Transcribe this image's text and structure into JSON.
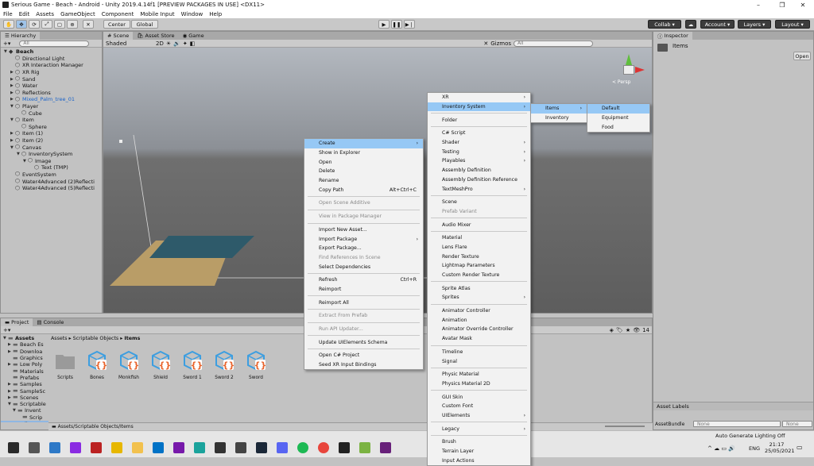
{
  "window": {
    "title": "Serious Game - Beach - Android - Unity 2019.4.14f1 [PREVIEW PACKAGES IN USE] <DX11>",
    "minimize_icon": "minimize-icon",
    "maximize_icon": "maximize-icon",
    "close_icon": "close-icon"
  },
  "menubar": [
    "File",
    "Edit",
    "Assets",
    "GameObject",
    "Component",
    "Mobile Input",
    "Window",
    "Help"
  ],
  "toolbar": {
    "pivot": "Center",
    "space": "Global",
    "collab": "Collab",
    "account": "Account",
    "layers": "Layers",
    "layout": "Layout"
  },
  "hierarchy": {
    "tab": "Hierarchy",
    "search_placeholder": "All",
    "items": [
      {
        "label": "Beach",
        "indent": 0,
        "arrow": "▼",
        "icon": "scene"
      },
      {
        "label": "Directional Light",
        "indent": 1,
        "arrow": "",
        "icon": "cube"
      },
      {
        "label": "XR Interaction Manager",
        "indent": 1,
        "arrow": "",
        "icon": "cube"
      },
      {
        "label": "XR Rig",
        "indent": 1,
        "arrow": "▶",
        "icon": "cube"
      },
      {
        "label": "Sand",
        "indent": 1,
        "arrow": "▶",
        "icon": "cube"
      },
      {
        "label": "Water",
        "indent": 1,
        "arrow": "▶",
        "icon": "cube"
      },
      {
        "label": "Reflections",
        "indent": 1,
        "arrow": "▶",
        "icon": "cube"
      },
      {
        "label": "Mixed_Palm_tree_01",
        "indent": 1,
        "arrow": "▶",
        "icon": "prefab",
        "blue": true
      },
      {
        "label": "Player",
        "indent": 1,
        "arrow": "▼",
        "icon": "cube"
      },
      {
        "label": "Cube",
        "indent": 2,
        "arrow": "",
        "icon": "cube"
      },
      {
        "label": "Item",
        "indent": 1,
        "arrow": "▼",
        "icon": "cube"
      },
      {
        "label": "Sphere",
        "indent": 2,
        "arrow": "",
        "icon": "cube"
      },
      {
        "label": "Item (1)",
        "indent": 1,
        "arrow": "▶",
        "icon": "cube"
      },
      {
        "label": "Item (2)",
        "indent": 1,
        "arrow": "▶",
        "icon": "cube"
      },
      {
        "label": "Canvas",
        "indent": 1,
        "arrow": "▼",
        "icon": "cube"
      },
      {
        "label": "InventorySystem",
        "indent": 2,
        "arrow": "▼",
        "icon": "cube"
      },
      {
        "label": "Image",
        "indent": 3,
        "arrow": "▼",
        "icon": "cube"
      },
      {
        "label": "Text (TMP)",
        "indent": 4,
        "arrow": "",
        "icon": "cube"
      },
      {
        "label": "EventSystem",
        "indent": 1,
        "arrow": "",
        "icon": "cube"
      },
      {
        "label": "Water4Advanced (2)Reflecti",
        "indent": 1,
        "arrow": "",
        "icon": "cube"
      },
      {
        "label": "Water4Advanced (5)Reflecti",
        "indent": 1,
        "arrow": "",
        "icon": "cube"
      }
    ]
  },
  "scene": {
    "tabs": [
      "Scene",
      "Asset Store",
      "Game"
    ],
    "shading": "Shaded",
    "mode_2d": "2D",
    "gizmos": "Gizmos",
    "search_placeholder": "All",
    "gizmo_label": "< Persp"
  },
  "inspector": {
    "tab": "Inspector",
    "title": "Items",
    "open_button": "Open",
    "asset_labels": "Asset Labels",
    "asset_bundle_label": "AssetBundle",
    "asset_bundle_value": "None",
    "asset_variant_value": "None"
  },
  "project": {
    "tabs": [
      "Project",
      "Console"
    ],
    "breadcrumb": [
      "Assets",
      "Scriptable Objects",
      "Items"
    ],
    "count": "14",
    "tree": [
      {
        "label": "Assets",
        "indent": 0,
        "arrow": "▼"
      },
      {
        "label": "Beach Es",
        "indent": 1,
        "arrow": "▶"
      },
      {
        "label": "Downloa",
        "indent": 1,
        "arrow": "▶"
      },
      {
        "label": "Graphics",
        "indent": 1,
        "arrow": ""
      },
      {
        "label": "Low Poly",
        "indent": 1,
        "arrow": "▶"
      },
      {
        "label": "Materials",
        "indent": 1,
        "arrow": ""
      },
      {
        "label": "Prefabs",
        "indent": 1,
        "arrow": ""
      },
      {
        "label": "Samples",
        "indent": 1,
        "arrow": "▶"
      },
      {
        "label": "SampleSc",
        "indent": 1,
        "arrow": "▶"
      },
      {
        "label": "Scenes",
        "indent": 1,
        "arrow": "▶"
      },
      {
        "label": "Scriptable",
        "indent": 1,
        "arrow": "▼"
      },
      {
        "label": "Invent",
        "indent": 2,
        "arrow": "▼"
      },
      {
        "label": "Scrip",
        "indent": 3,
        "arrow": ""
      },
      {
        "label": "Items",
        "indent": 2,
        "arrow": "",
        "selected": true
      }
    ],
    "assets": [
      {
        "label": "Scripts",
        "type": "folder"
      },
      {
        "label": "Bones",
        "type": "scriptable"
      },
      {
        "label": "Monkfish",
        "type": "scriptable"
      },
      {
        "label": "Shield",
        "type": "scriptable"
      },
      {
        "label": "Sword 1",
        "type": "scriptable"
      },
      {
        "label": "Sword 2",
        "type": "scriptable"
      },
      {
        "label": "Sword",
        "type": "scriptable"
      }
    ],
    "footer_path": "Assets/Scriptable Objects/Items"
  },
  "status": {
    "lighting": "Auto Generate Lighting Off"
  },
  "context_menu": [
    {
      "label": "Create",
      "sub": true,
      "hl": true
    },
    {
      "label": "Show in Explorer"
    },
    {
      "label": "Open"
    },
    {
      "label": "Delete"
    },
    {
      "label": "Rename"
    },
    {
      "label": "Copy Path",
      "shortcut": "Alt+Ctrl+C"
    },
    {
      "sep": true
    },
    {
      "label": "Open Scene Additive",
      "disabled": true
    },
    {
      "sep": true
    },
    {
      "label": "View in Package Manager",
      "disabled": true
    },
    {
      "sep": true
    },
    {
      "label": "Import New Asset..."
    },
    {
      "label": "Import Package",
      "sub": true
    },
    {
      "label": "Export Package..."
    },
    {
      "label": "Find References In Scene",
      "disabled": true
    },
    {
      "label": "Select Dependencies"
    },
    {
      "sep": true
    },
    {
      "label": "Refresh",
      "shortcut": "Ctrl+R"
    },
    {
      "label": "Reimport"
    },
    {
      "sep": true
    },
    {
      "label": "Reimport All"
    },
    {
      "sep": true
    },
    {
      "label": "Extract From Prefab",
      "disabled": true
    },
    {
      "sep": true
    },
    {
      "label": "Run API Updater...",
      "disabled": true
    },
    {
      "sep": true
    },
    {
      "label": "Update UIElements Schema"
    },
    {
      "sep": true
    },
    {
      "label": "Open C# Project"
    },
    {
      "label": "Seed XR Input Bindings"
    }
  ],
  "create_menu": [
    {
      "label": "XR",
      "sub": true
    },
    {
      "label": "Inventory System",
      "sub": true,
      "hl": true
    },
    {
      "sep": true
    },
    {
      "label": "Folder"
    },
    {
      "sep": true
    },
    {
      "label": "C# Script"
    },
    {
      "label": "Shader",
      "sub": true
    },
    {
      "label": "Testing",
      "sub": true
    },
    {
      "label": "Playables",
      "sub": true
    },
    {
      "label": "Assembly Definition"
    },
    {
      "label": "Assembly Definition Reference"
    },
    {
      "label": "TextMeshPro",
      "sub": true
    },
    {
      "sep": true
    },
    {
      "label": "Scene"
    },
    {
      "label": "Prefab Variant",
      "disabled": true
    },
    {
      "sep": true
    },
    {
      "label": "Audio Mixer"
    },
    {
      "sep": true
    },
    {
      "label": "Material"
    },
    {
      "label": "Lens Flare"
    },
    {
      "label": "Render Texture"
    },
    {
      "label": "Lightmap Parameters"
    },
    {
      "label": "Custom Render Texture"
    },
    {
      "sep": true
    },
    {
      "label": "Sprite Atlas"
    },
    {
      "label": "Sprites",
      "sub": true
    },
    {
      "sep": true
    },
    {
      "label": "Animator Controller"
    },
    {
      "label": "Animation"
    },
    {
      "label": "Animator Override Controller"
    },
    {
      "label": "Avatar Mask"
    },
    {
      "sep": true
    },
    {
      "label": "Timeline"
    },
    {
      "label": "Signal"
    },
    {
      "sep": true
    },
    {
      "label": "Physic Material"
    },
    {
      "label": "Physics Material 2D"
    },
    {
      "sep": true
    },
    {
      "label": "GUI Skin"
    },
    {
      "label": "Custom Font"
    },
    {
      "label": "UIElements",
      "sub": true
    },
    {
      "sep": true
    },
    {
      "label": "Legacy",
      "sub": true
    },
    {
      "sep": true
    },
    {
      "label": "Brush"
    },
    {
      "label": "Terrain Layer"
    },
    {
      "label": "Input Actions"
    }
  ],
  "inventory_menu": [
    {
      "label": "Items",
      "sub": true,
      "hl": true
    },
    {
      "label": "Inventory"
    }
  ],
  "items_menu": [
    {
      "label": "Default",
      "hl": true
    },
    {
      "label": "Equipment"
    },
    {
      "label": "Food"
    }
  ],
  "taskbar": {
    "language": "ENG",
    "time": "21:17",
    "date": "25/05/2021"
  },
  "colors": {
    "highlight": "#96c8f5",
    "scriptable_icon": "#3d9ee0",
    "scriptable_braces": "#e8632b"
  }
}
